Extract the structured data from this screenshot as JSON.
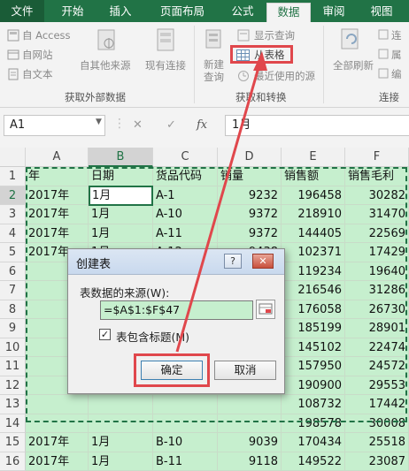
{
  "ribbon_tabs": [
    "文件",
    "开始",
    "插入",
    "页面布局",
    "公式",
    "数据",
    "审阅",
    "视图"
  ],
  "ribbon": {
    "get_external": {
      "access": "自 Access",
      "web": "自网站",
      "text": "自文本",
      "other": "自其他来源",
      "existing": "现有连接",
      "label": "获取外部数据"
    },
    "transform": {
      "new_query": "新建\n查询",
      "show_queries": "显示查询",
      "from_table": "从表格",
      "recent_sources": "最近使用的源",
      "label": "获取和转换"
    },
    "connections": {
      "refresh_all": "全部刷新",
      "connections": "连",
      "properties": "属",
      "edit_links": "编",
      "label": "连接"
    }
  },
  "formula_bar": {
    "name_box": "A1",
    "fx": "fx",
    "content": "1月"
  },
  "columns": [
    "A",
    "B",
    "C",
    "D",
    "E",
    "F"
  ],
  "rows": [
    "1",
    "2",
    "3",
    "4",
    "5",
    "6",
    "7",
    "8",
    "9",
    "10",
    "11",
    "12",
    "13",
    "14",
    "15",
    "16"
  ],
  "cells": [
    [
      "年",
      "日期",
      "货品代码",
      "销量",
      "销售额",
      "销售毛利"
    ],
    [
      "2017年",
      "1月",
      "A-1",
      "9232",
      "196458",
      "30282"
    ],
    [
      "2017年",
      "1月",
      "A-10",
      "9372",
      "218910",
      "31470"
    ],
    [
      "2017年",
      "1月",
      "A-11",
      "9372",
      "144405",
      "22569"
    ],
    [
      "2017年",
      "1月",
      "A-12",
      "9438",
      "102371",
      "17429"
    ],
    [
      "",
      "",
      "",
      "",
      "119234",
      "19640"
    ],
    [
      "",
      "",
      "",
      "",
      "216546",
      "31286"
    ],
    [
      "",
      "",
      "",
      "",
      "176058",
      "26730"
    ],
    [
      "",
      "",
      "",
      "",
      "185199",
      "28901"
    ],
    [
      "",
      "",
      "",
      "",
      "145102",
      "22474"
    ],
    [
      "",
      "",
      "",
      "",
      "157950",
      "24572"
    ],
    [
      "",
      "",
      "",
      "",
      "190900",
      "29553"
    ],
    [
      "",
      "",
      "",
      "",
      "108732",
      "17442"
    ],
    [
      "",
      "",
      "",
      "",
      "198578",
      "30008"
    ],
    [
      "2017年",
      "1月",
      "B-10",
      "9039",
      "170434",
      "25518"
    ],
    [
      "2017年",
      "1月",
      "B-11",
      "9118",
      "149522",
      "23087"
    ]
  ],
  "dialog": {
    "title": "创建表",
    "help": "?",
    "close": "✕",
    "range_label": "表数据的来源(W):",
    "range_value": "=$A$1:$F$47",
    "checkbox_checked": true,
    "checkbox_mark": "✓",
    "checkbox_label": "表包含标题(M)",
    "ok": "确定",
    "cancel": "取消"
  },
  "colors": {
    "excel_green": "#217346",
    "cell_fill": "#c6efce",
    "highlight_red": "#e0474c"
  }
}
